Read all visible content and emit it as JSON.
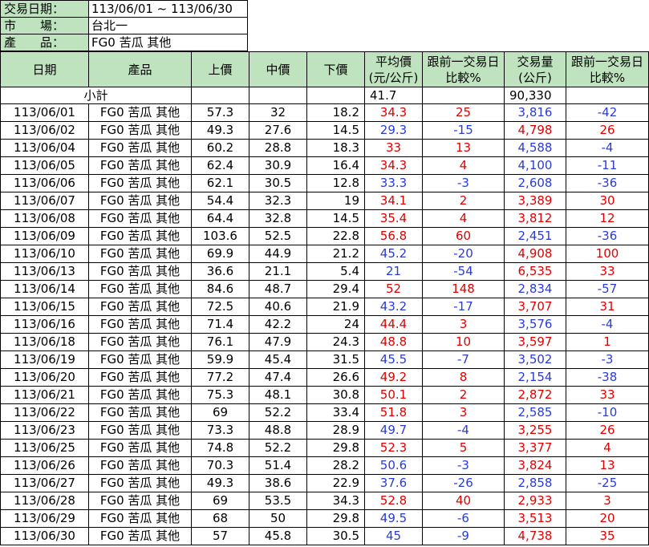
{
  "info": {
    "date_label": "交易日期：",
    "date_value": "113/06/01 ~ 113/06/30",
    "market_label": "市　　場：",
    "market_value": "台北一",
    "product_label": "產　　品：",
    "product_value": "FG0 苦瓜 其他"
  },
  "headers": {
    "date": "日期",
    "product": "產品",
    "upper": "上價",
    "middle": "中價",
    "lower": "下價",
    "avg_line1": "平均價",
    "avg_line2": "(元/公斤)",
    "avg_cmp_line1": "跟前一交易日",
    "avg_cmp_line2": "比較%",
    "vol_line1": "交易量",
    "vol_line2": "(公斤)",
    "vol_cmp_line1": "跟前一交易日",
    "vol_cmp_line2": "比較%"
  },
  "subtotal": {
    "label": "小計",
    "avg": "41.7",
    "volume": "90,330"
  },
  "colors": {
    "header_bg": "#bfe3bf",
    "up": "#e00000",
    "down": "#2a3bd8"
  },
  "rows": [
    {
      "date": "113/06/01",
      "product": "FG0 苦瓜 其他",
      "upper": "57.3",
      "middle": "32",
      "lower": "18.2",
      "avg": "34.3",
      "avg_cmp": "25",
      "volume": "3,816",
      "vol_cmp": "-42"
    },
    {
      "date": "113/06/02",
      "product": "FG0 苦瓜 其他",
      "upper": "49.3",
      "middle": "27.6",
      "lower": "14.5",
      "avg": "29.3",
      "avg_cmp": "-15",
      "volume": "4,798",
      "vol_cmp": "26"
    },
    {
      "date": "113/06/04",
      "product": "FG0 苦瓜 其他",
      "upper": "60.2",
      "middle": "28.8",
      "lower": "18.3",
      "avg": "33",
      "avg_cmp": "13",
      "volume": "4,588",
      "vol_cmp": "-4"
    },
    {
      "date": "113/06/05",
      "product": "FG0 苦瓜 其他",
      "upper": "62.4",
      "middle": "30.9",
      "lower": "16.4",
      "avg": "34.3",
      "avg_cmp": "4",
      "volume": "4,100",
      "vol_cmp": "-11"
    },
    {
      "date": "113/06/06",
      "product": "FG0 苦瓜 其他",
      "upper": "62.1",
      "middle": "30.5",
      "lower": "12.8",
      "avg": "33.3",
      "avg_cmp": "-3",
      "volume": "2,608",
      "vol_cmp": "-36"
    },
    {
      "date": "113/06/07",
      "product": "FG0 苦瓜 其他",
      "upper": "54.4",
      "middle": "32.3",
      "lower": "19",
      "avg": "34.1",
      "avg_cmp": "2",
      "volume": "3,389",
      "vol_cmp": "30"
    },
    {
      "date": "113/06/08",
      "product": "FG0 苦瓜 其他",
      "upper": "64.4",
      "middle": "32.8",
      "lower": "14.5",
      "avg": "35.4",
      "avg_cmp": "4",
      "volume": "3,812",
      "vol_cmp": "12"
    },
    {
      "date": "113/06/09",
      "product": "FG0 苦瓜 其他",
      "upper": "103.6",
      "middle": "52.5",
      "lower": "22.8",
      "avg": "56.8",
      "avg_cmp": "60",
      "volume": "2,451",
      "vol_cmp": "-36"
    },
    {
      "date": "113/06/10",
      "product": "FG0 苦瓜 其他",
      "upper": "69.9",
      "middle": "44.9",
      "lower": "21.2",
      "avg": "45.2",
      "avg_cmp": "-20",
      "volume": "4,908",
      "vol_cmp": "100"
    },
    {
      "date": "113/06/13",
      "product": "FG0 苦瓜 其他",
      "upper": "36.6",
      "middle": "21.1",
      "lower": "5.4",
      "avg": "21",
      "avg_cmp": "-54",
      "volume": "6,535",
      "vol_cmp": "33"
    },
    {
      "date": "113/06/14",
      "product": "FG0 苦瓜 其他",
      "upper": "84.6",
      "middle": "48.7",
      "lower": "29.4",
      "avg": "52",
      "avg_cmp": "148",
      "volume": "2,834",
      "vol_cmp": "-57"
    },
    {
      "date": "113/06/15",
      "product": "FG0 苦瓜 其他",
      "upper": "72.5",
      "middle": "40.6",
      "lower": "21.9",
      "avg": "43.2",
      "avg_cmp": "-17",
      "volume": "3,707",
      "vol_cmp": "31"
    },
    {
      "date": "113/06/16",
      "product": "FG0 苦瓜 其他",
      "upper": "71.4",
      "middle": "42.2",
      "lower": "24",
      "avg": "44.4",
      "avg_cmp": "3",
      "volume": "3,576",
      "vol_cmp": "-4"
    },
    {
      "date": "113/06/18",
      "product": "FG0 苦瓜 其他",
      "upper": "76.1",
      "middle": "47.9",
      "lower": "24.3",
      "avg": "48.8",
      "avg_cmp": "10",
      "volume": "3,597",
      "vol_cmp": "1"
    },
    {
      "date": "113/06/19",
      "product": "FG0 苦瓜 其他",
      "upper": "59.9",
      "middle": "45.4",
      "lower": "31.5",
      "avg": "45.5",
      "avg_cmp": "-7",
      "volume": "3,502",
      "vol_cmp": "-3"
    },
    {
      "date": "113/06/20",
      "product": "FG0 苦瓜 其他",
      "upper": "77.2",
      "middle": "47.4",
      "lower": "26.6",
      "avg": "49.2",
      "avg_cmp": "8",
      "volume": "2,154",
      "vol_cmp": "-38"
    },
    {
      "date": "113/06/21",
      "product": "FG0 苦瓜 其他",
      "upper": "75.3",
      "middle": "48.1",
      "lower": "30.8",
      "avg": "50.1",
      "avg_cmp": "2",
      "volume": "2,872",
      "vol_cmp": "33"
    },
    {
      "date": "113/06/22",
      "product": "FG0 苦瓜 其他",
      "upper": "69",
      "middle": "52.2",
      "lower": "33.4",
      "avg": "51.8",
      "avg_cmp": "3",
      "volume": "2,585",
      "vol_cmp": "-10"
    },
    {
      "date": "113/06/23",
      "product": "FG0 苦瓜 其他",
      "upper": "73.3",
      "middle": "48.8",
      "lower": "28.9",
      "avg": "49.7",
      "avg_cmp": "-4",
      "volume": "3,255",
      "vol_cmp": "26"
    },
    {
      "date": "113/06/25",
      "product": "FG0 苦瓜 其他",
      "upper": "74.8",
      "middle": "52.2",
      "lower": "29.8",
      "avg": "52.3",
      "avg_cmp": "5",
      "volume": "3,377",
      "vol_cmp": "4"
    },
    {
      "date": "113/06/26",
      "product": "FG0 苦瓜 其他",
      "upper": "70.3",
      "middle": "51.4",
      "lower": "28.2",
      "avg": "50.6",
      "avg_cmp": "-3",
      "volume": "3,824",
      "vol_cmp": "13"
    },
    {
      "date": "113/06/27",
      "product": "FG0 苦瓜 其他",
      "upper": "49.3",
      "middle": "38.6",
      "lower": "22.9",
      "avg": "37.6",
      "avg_cmp": "-26",
      "volume": "2,858",
      "vol_cmp": "-25"
    },
    {
      "date": "113/06/28",
      "product": "FG0 苦瓜 其他",
      "upper": "69",
      "middle": "53.5",
      "lower": "34.3",
      "avg": "52.8",
      "avg_cmp": "40",
      "volume": "2,933",
      "vol_cmp": "3"
    },
    {
      "date": "113/06/29",
      "product": "FG0 苦瓜 其他",
      "upper": "68",
      "middle": "50",
      "lower": "29.8",
      "avg": "49.5",
      "avg_cmp": "-6",
      "volume": "3,513",
      "vol_cmp": "20"
    },
    {
      "date": "113/06/30",
      "product": "FG0 苦瓜 其他",
      "upper": "57",
      "middle": "45.8",
      "lower": "30.5",
      "avg": "45",
      "avg_cmp": "-9",
      "volume": "4,738",
      "vol_cmp": "35"
    }
  ]
}
